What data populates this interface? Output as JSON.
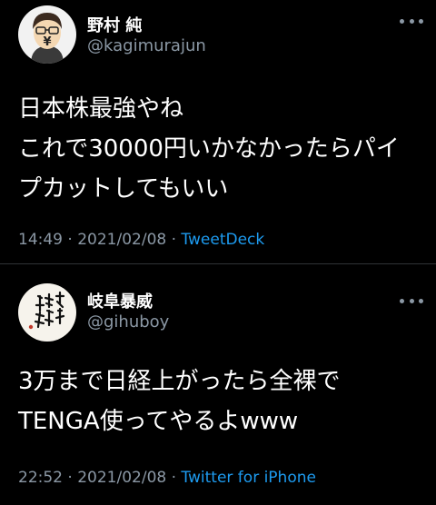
{
  "tweets": [
    {
      "display_name": "野村 純",
      "handle": "@kagimurajun",
      "avatar": "cartoon-avatar-yen-sign-glasses",
      "text_lines": [
        "日本株最強やね",
        "これで30000円いかなかったらパイ",
        "プカットしてもいい"
      ],
      "time": "14:49",
      "date": "2021/02/08",
      "source": "TweetDeck"
    },
    {
      "display_name": "岐阜暴威",
      "handle": "@gihuboy",
      "avatar": "calligraphy-avatar",
      "text_lines": [
        "3万まで日経上がったら全裸で",
        "TENGA使ってやるよwww"
      ],
      "time": "22:52",
      "date": "2021/02/08",
      "source": "Twitter for iPhone"
    }
  ],
  "separator": "·",
  "colors": {
    "background": "#000000",
    "primary_text": "#ffffff",
    "secondary_text": "#8b98a5",
    "link": "#1d9bf0",
    "divider": "#2f3336"
  }
}
